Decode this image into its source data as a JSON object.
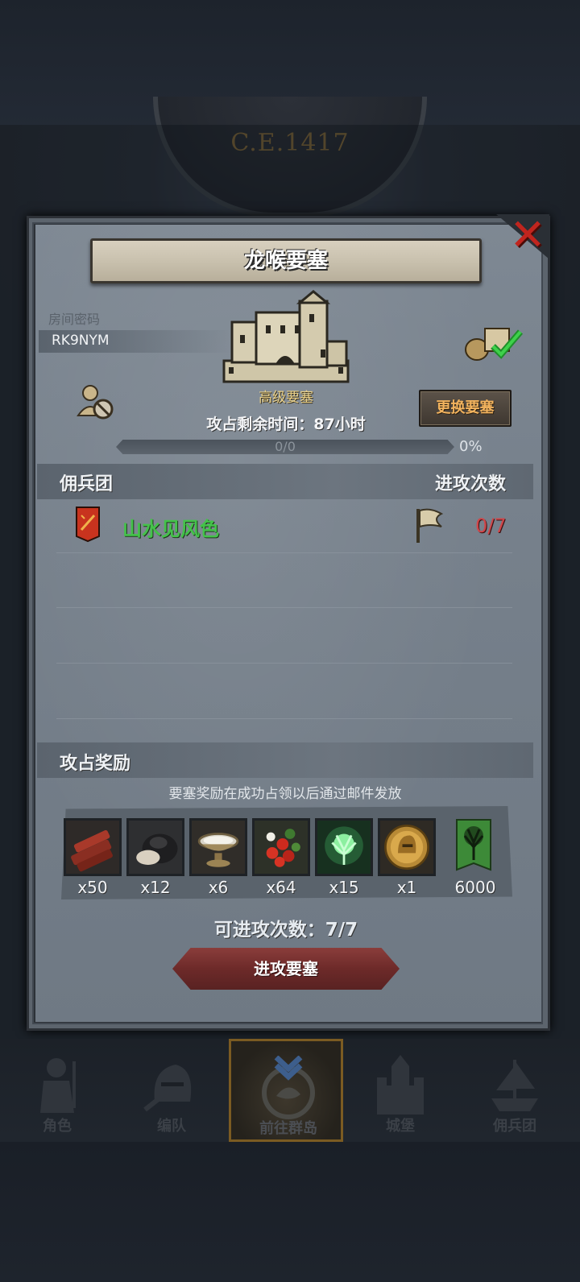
{
  "era": "C.E.1417",
  "dialog": {
    "title": "龙喉要塞",
    "room_code_label": "房间密码",
    "room_code": "RK9NYM",
    "fortress_type": "高级要塞",
    "time_label": "攻占剩余时间：87小时",
    "progress_text": "0/0",
    "progress_percent": "0%",
    "progress_value": 0,
    "change_button": "更换要塞",
    "mercenary_header": "佣兵团",
    "attack_count_header": "进攻次数",
    "mercenaries": [
      {
        "name": "山水见风色",
        "attacks": "0/7"
      }
    ],
    "rewards_header": "攻占奖励",
    "rewards_note": "要塞奖励在成功占领以后通过邮件发放",
    "rewards": [
      {
        "icon": "wood-logs-icon",
        "qty": "x50"
      },
      {
        "icon": "ore-stone-icon",
        "qty": "x12"
      },
      {
        "icon": "silver-bowl-icon",
        "qty": "x6"
      },
      {
        "icon": "red-berries-icon",
        "qty": "x64"
      },
      {
        "icon": "green-tree-spirit-icon",
        "qty": "x15"
      },
      {
        "icon": "golden-helmet-medal-icon",
        "qty": "x1"
      },
      {
        "icon": "tree-banner-icon",
        "qty": "6000"
      }
    ],
    "attempts_label": "可进攻次数：7/7",
    "attack_button": "进攻要塞"
  },
  "nav": [
    {
      "label": "角色",
      "icon": "knight-icon"
    },
    {
      "label": "编队",
      "icon": "helmet-icon"
    },
    {
      "label": "前往群岛",
      "icon": "compass-icon",
      "active": true
    },
    {
      "label": "城堡",
      "icon": "castle-icon"
    },
    {
      "label": "佣兵团",
      "icon": "ship-icon"
    }
  ],
  "colors": {
    "merc_name": "#44c24a",
    "attack_count": "#d0464a",
    "change_button_text": "#f2b35e",
    "close_x": "#c0251e"
  }
}
